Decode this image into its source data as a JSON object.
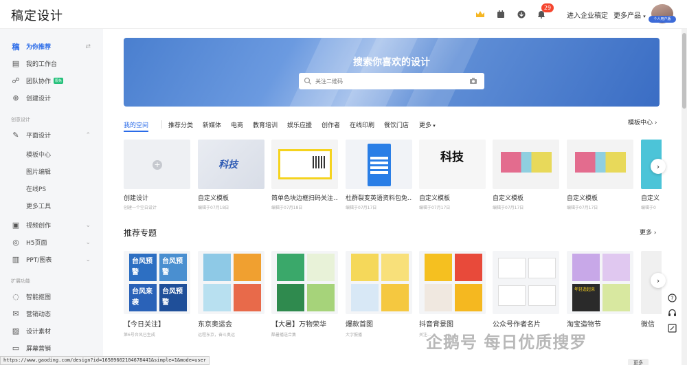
{
  "header": {
    "logo": "稿定设计",
    "badge_count": "29",
    "enterprise_link": "进入企业稿定",
    "more_products": "更多产品",
    "avatar_tag": "个人用户版"
  },
  "sidebar": {
    "items": [
      {
        "label": "为你推荐",
        "icon": "recommend-icon"
      },
      {
        "label": "我的工作台",
        "icon": "workspace-icon"
      },
      {
        "label": "团队协作",
        "icon": "team-icon",
        "tag": "限免"
      },
      {
        "label": "创建设计",
        "icon": "create-icon"
      }
    ],
    "section_create": "创意设计",
    "flat_design": "平面设计",
    "flat_subs": [
      "模板中心",
      "图片编辑",
      "在线PS",
      "更多工具"
    ],
    "items2": [
      {
        "label": "视频创作",
        "icon": "video-icon"
      },
      {
        "label": "H5页面",
        "icon": "h5-icon"
      },
      {
        "label": "PPT/图表",
        "icon": "ppt-icon"
      }
    ],
    "section_ext": "扩展功能",
    "items3": [
      {
        "label": "智能抠图",
        "icon": "cutout-icon"
      },
      {
        "label": "营销动态",
        "icon": "marketing-icon"
      },
      {
        "label": "设计素材",
        "icon": "material-icon"
      },
      {
        "label": "屏幕营销",
        "icon": "screen-icon"
      }
    ]
  },
  "banner": {
    "title": "搜索你喜欢的设计",
    "search_placeholder": "关注二维码"
  },
  "tabs": [
    "我的空间",
    "推荐分类",
    "新媒体",
    "电商",
    "教育培训",
    "娱乐应援",
    "创作者",
    "在线印刷",
    "餐饮门店",
    "更多"
  ],
  "template_center": "模板中心",
  "templates": [
    {
      "name": "创建设计",
      "sub": "创建一个空白设计"
    },
    {
      "name": "自定义模板",
      "sub": "编辑于07月18日",
      "thumb_text": "科技"
    },
    {
      "name": "简单色块边框扫码关注...",
      "sub": "编辑于07月18日"
    },
    {
      "name": "杜群裂变英语资料包免...",
      "sub": "编辑于07月17日"
    },
    {
      "name": "自定义模板",
      "sub": "编辑于07月17日",
      "thumb_text": "科技"
    },
    {
      "name": "自定义模板",
      "sub": "编辑于07月17日"
    },
    {
      "name": "自定义模板",
      "sub": "编辑于07月17日"
    },
    {
      "name": "自定义",
      "sub": "编辑于0"
    }
  ],
  "topics_title": "推荐专题",
  "topics_more": "更多",
  "topics": [
    {
      "name": "【今日关注】",
      "sub": "第6号台风已生成",
      "thumb_texts": [
        "台风预警",
        "台风预警",
        "台风来袭",
        "台风预警"
      ]
    },
    {
      "name": "东京奥运会",
      "sub": "远程东京，奋斗奥运"
    },
    {
      "name": "【大暑】万物荣华",
      "sub": "酷暑播送合集"
    },
    {
      "name": "爆款首图",
      "sub": "大字报播"
    },
    {
      "name": "抖音背景图",
      "sub": "关注..."
    },
    {
      "name": "公众号作者名片",
      "sub": ""
    },
    {
      "name": "淘宝造物节",
      "sub": "年轻造起来"
    },
    {
      "name": "微信",
      "sub": ""
    }
  ],
  "status_url": "https://www.gaoding.com/design?id=16589602104678441&simple=1&mode=user",
  "watermark": "企鹅号 每日优质搜罗",
  "more_button": "更多",
  "colors": {
    "accent": "#2a6be8",
    "badge": "#f5452e",
    "new_tag": "#23c07a"
  }
}
